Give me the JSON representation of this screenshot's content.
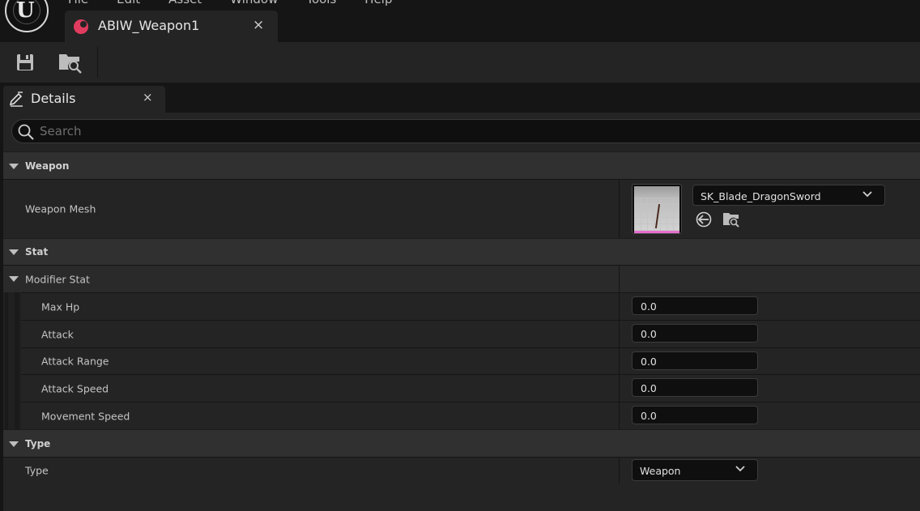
{
  "menu": [
    "File",
    "Edit",
    "Asset",
    "Window",
    "Tools",
    "Help"
  ],
  "document_tab": {
    "title": "ABIW_Weapon1",
    "close": "×"
  },
  "toolbar": {
    "save": "Save",
    "browse": "Browse to Asset"
  },
  "details_tab": {
    "title": "Details",
    "close": "×"
  },
  "search": {
    "placeholder": "Search"
  },
  "categories": {
    "weapon": "Weapon",
    "stat": "Stat",
    "modifier_stat": "Modifier Stat",
    "type": "Type"
  },
  "weapon": {
    "mesh_label": "Weapon Mesh",
    "mesh_value": "SK_Blade_DragonSword"
  },
  "stats": [
    {
      "label": "Max Hp",
      "value": "0.0"
    },
    {
      "label": "Attack",
      "value": "0.0"
    },
    {
      "label": "Attack Range",
      "value": "0.0"
    },
    {
      "label": "Attack Speed",
      "value": "0.0"
    },
    {
      "label": "Movement Speed",
      "value": "0.0"
    }
  ],
  "type": {
    "label": "Type",
    "value": "Weapon"
  },
  "colors": {
    "asset_tab_accent": "#e03c5f",
    "panel_bg": "#242424",
    "category_bg": "#303030",
    "field_bg": "#0f0f0f"
  }
}
